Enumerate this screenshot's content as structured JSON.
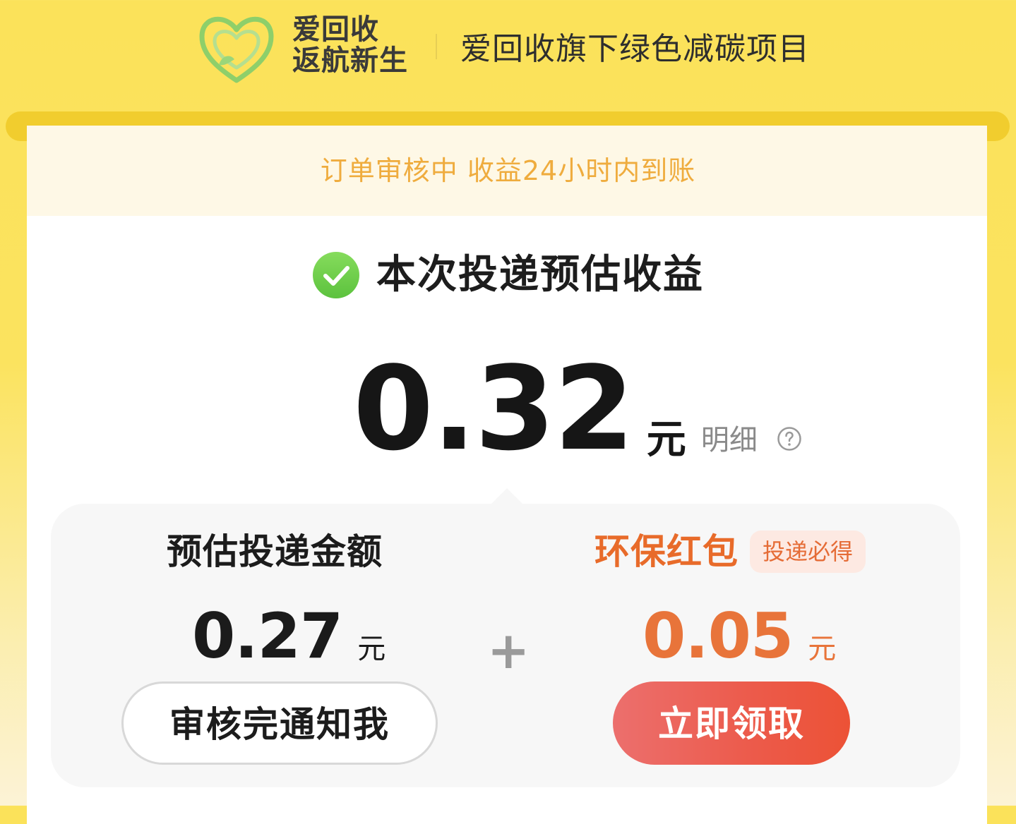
{
  "header": {
    "brand_line1": "爱回收",
    "brand_line2": "返航新生",
    "slogan": "爱回收旗下绿色减碳项目",
    "logo_icon": "heart-leaf-icon"
  },
  "notice": {
    "text": "订单审核中 收益24小时内到账"
  },
  "estimate": {
    "title": "本次投递预估收益",
    "total_amount": "0.32",
    "unit": "元",
    "detail_label": "明细",
    "help_icon": "question-circle-icon"
  },
  "breakdown": {
    "left": {
      "title": "预估投递金额",
      "amount": "0.27",
      "unit": "元",
      "button_label": "审核完通知我"
    },
    "plus": "+",
    "right": {
      "title": "环保红包",
      "tag": "投递必得",
      "amount": "0.05",
      "unit": "元",
      "button_label": "立即领取"
    }
  },
  "colors": {
    "brand_yellow": "#fbe25a",
    "notice_orange": "#efac3e",
    "accent_orange": "#e8743a",
    "claim_red": "#ec5a4a",
    "success_green": "#6ccf4c"
  }
}
